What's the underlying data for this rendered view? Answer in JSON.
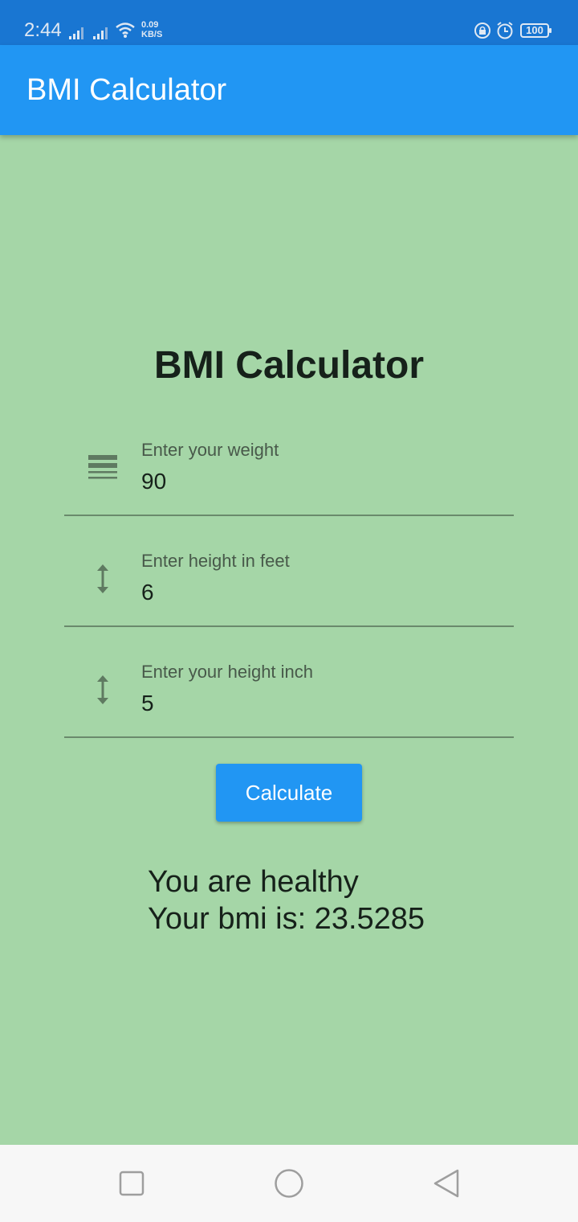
{
  "status_bar": {
    "time": "2:44",
    "net_speed_value": "0.09",
    "net_speed_unit": "KB/S",
    "battery": "100",
    "icons": [
      "signal-icon",
      "signal-icon",
      "wifi-icon",
      "rotation-lock-icon",
      "alarm-icon",
      "battery-icon"
    ]
  },
  "app_bar": {
    "title": "BMI Calculator",
    "color": "#2196f3"
  },
  "main": {
    "heading": "BMI Calculator",
    "background": "#a5d6a7",
    "fields": [
      {
        "label": "Enter your weight",
        "value": "90",
        "icon": "weight-lines-icon"
      },
      {
        "label": "Enter height in feet",
        "value": "6",
        "icon": "vertical-arrows-icon"
      },
      {
        "label": "Enter your height inch",
        "value": "5",
        "icon": "vertical-arrows-icon"
      }
    ],
    "button_label": "Calculate",
    "result_line1": "You are healthy",
    "result_line2": "Your bmi is: 23.5285"
  },
  "nav_bar": {
    "buttons": [
      "recent-apps-icon",
      "home-icon",
      "back-icon"
    ]
  }
}
